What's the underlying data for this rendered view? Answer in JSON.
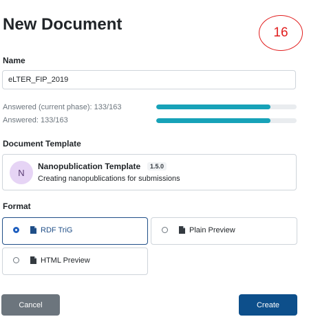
{
  "header": {
    "title": "New Document",
    "step_number": "16"
  },
  "name": {
    "label": "Name",
    "value": "eLTER_FIP_2019"
  },
  "progress": [
    {
      "label": "Answered (current phase): 133/163",
      "fraction": 0.816
    },
    {
      "label": "Answered: 133/163",
      "fraction": 0.816
    }
  ],
  "template": {
    "label": "Document Template",
    "avatar_letter": "N",
    "name": "Nanopublication Template",
    "version": "1.5.0",
    "description": "Creating nanopublications for submissions"
  },
  "format": {
    "label": "Format",
    "options": [
      {
        "label": "RDF TriG",
        "selected": true
      },
      {
        "label": "Plain Preview",
        "selected": false
      },
      {
        "label": "HTML Preview",
        "selected": false
      }
    ]
  },
  "actions": {
    "cancel": "Cancel",
    "create": "Create"
  },
  "colors": {
    "accent": "#0d4f8b",
    "progress": "#17a2b8",
    "annotation": "#e11d1d"
  }
}
